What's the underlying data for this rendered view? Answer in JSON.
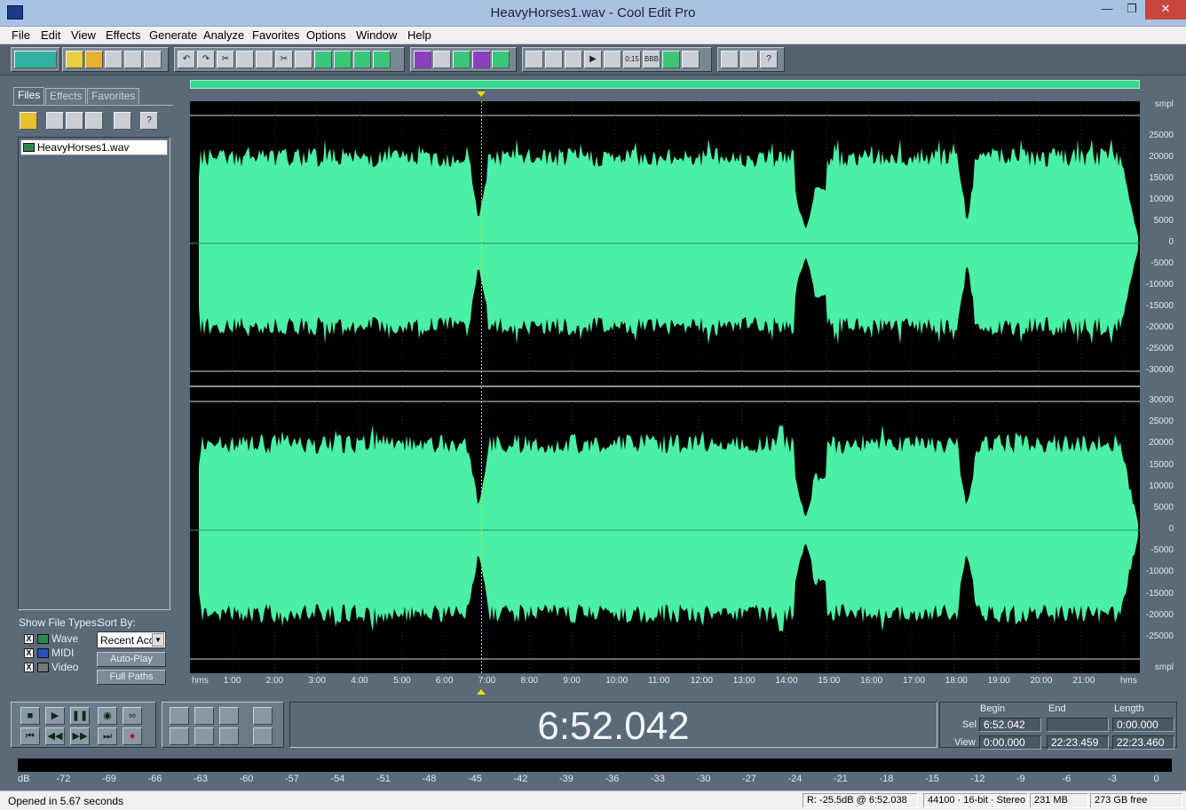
{
  "window": {
    "title": "HeavyHorses1.wav - Cool Edit Pro",
    "minimize": "—",
    "maximize": "❐",
    "close": "✕"
  },
  "menu": [
    "File",
    "Edit",
    "View",
    "Effects",
    "Generate",
    "Analyze",
    "Favorites",
    "Options",
    "Window",
    "Help"
  ],
  "left_panel": {
    "tabs": [
      "Files",
      "Effects",
      "Favorites"
    ],
    "files": [
      "HeavyHorses1.wav"
    ],
    "show_file_types_label": "Show File Types:",
    "file_types": [
      {
        "label": "Wave",
        "checked": "X"
      },
      {
        "label": "MIDI",
        "checked": "X"
      },
      {
        "label": "Video",
        "checked": "X"
      }
    ],
    "sort_by_label": "Sort By:",
    "sort_by_value": "Recent Acc",
    "auto_play": "Auto-Play",
    "full_paths": "Full Paths"
  },
  "waveform": {
    "wave_color": "#4af0a4",
    "cursor_color": "#e8e000",
    "amplitude_unit": "smpl",
    "time_unit": "hms",
    "amplitude_ticks": [
      "30000",
      "25000",
      "20000",
      "15000",
      "10000",
      "5000",
      "0",
      "-5000",
      "-10000",
      "-15000",
      "-20000",
      "-25000",
      "-30000"
    ],
    "time_ticks": [
      "1:00",
      "2:00",
      "3:00",
      "4:00",
      "5:00",
      "6:00",
      "7:00",
      "8:00",
      "9:00",
      "10:00",
      "11:00",
      "12:00",
      "13:00",
      "14:00",
      "15:00",
      "16:00",
      "17:00",
      "18:00",
      "19:00",
      "20:00",
      "21:00"
    ],
    "total_minutes": 22.3743,
    "cursor_minutes": 6.8674
  },
  "time_display": "6:52.042",
  "selection": {
    "headers": [
      "Begin",
      "End",
      "Length"
    ],
    "sel_label": "Sel",
    "view_label": "View",
    "sel": [
      "6:52.042",
      "",
      "0:00.000"
    ],
    "view": [
      "0:00.000",
      "22:23.459",
      "22:23.460"
    ]
  },
  "level_meter": {
    "scale": [
      "dB",
      "-72",
      "-69",
      "-66",
      "-63",
      "-60",
      "-57",
      "-54",
      "-51",
      "-48",
      "-45",
      "-42",
      "-39",
      "-36",
      "-33",
      "-30",
      "-27",
      "-24",
      "-21",
      "-18",
      "-15",
      "-12",
      "-9",
      "-6",
      "-3",
      "0"
    ]
  },
  "status": {
    "message": "Opened in 5.67 seconds",
    "cursor_info": "R: -25.5dB @  6:52.038",
    "format": "44100 · 16-bit · Stereo",
    "size": "231 MB",
    "free": "273 GB free"
  }
}
